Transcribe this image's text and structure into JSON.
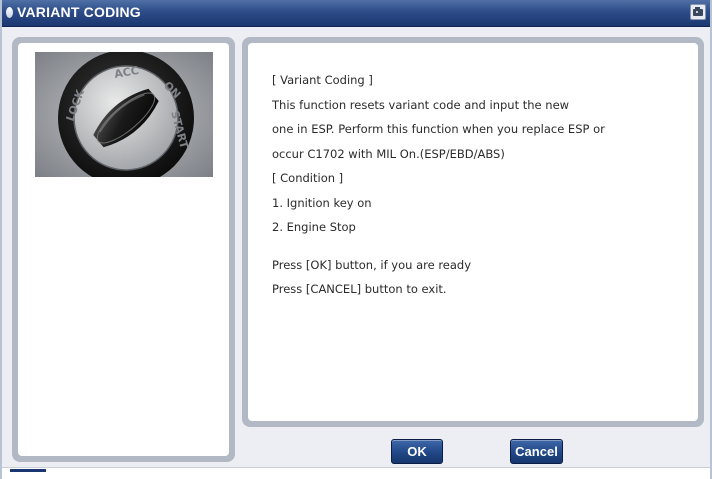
{
  "window": {
    "title": "VARIANT CODING",
    "title_icon": "bullet-icon",
    "capture_icon": "camera-icon"
  },
  "image": {
    "subject": "ignition-key-switch-photo",
    "switch_labels": [
      "LOCK",
      "ACC",
      "ON",
      "START"
    ]
  },
  "message": {
    "lines": [
      "[ Variant Coding ]",
      "This function resets variant code and input the new",
      "one in ESP. Perform this function when you replace ESP or",
      "occur C1702 with MIL On.(ESP/EBD/ABS)",
      "[ Condition ]",
      "1. Ignition key on",
      "2. Engine Stop"
    ],
    "prompt_lines": [
      "Press [OK] button, if you are ready",
      "Press [CANCEL] button to exit."
    ]
  },
  "buttons": {
    "ok_label": "OK",
    "cancel_label": "Cancel"
  },
  "colors": {
    "title_bar": "#2d4c88",
    "button": "#234a8a",
    "panel_frame": "#b2b9c5",
    "client_bg": "#eceef3"
  }
}
